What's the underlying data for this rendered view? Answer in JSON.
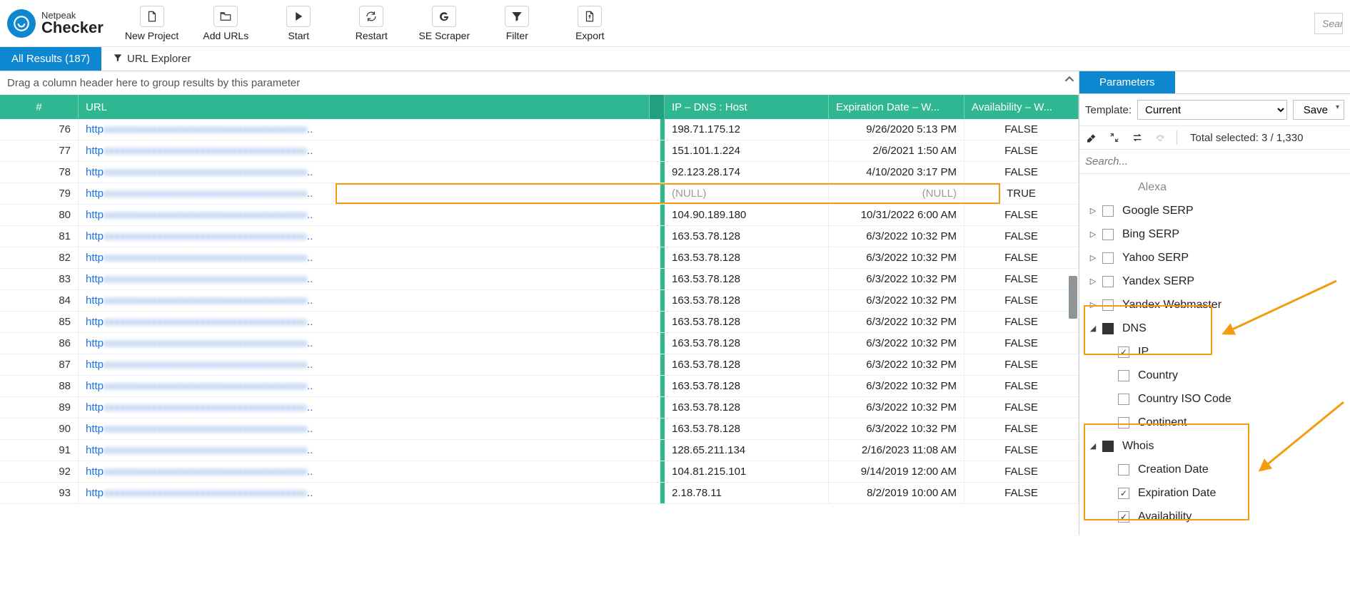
{
  "brand": {
    "top": "Netpeak",
    "product": "Checker"
  },
  "toolbar": [
    {
      "id": "new-project",
      "label": "New Project",
      "icon": "file"
    },
    {
      "id": "add-urls",
      "label": "Add URLs",
      "icon": "folder"
    },
    {
      "id": "start",
      "label": "Start",
      "icon": "play"
    },
    {
      "id": "restart",
      "label": "Restart",
      "icon": "refresh"
    },
    {
      "id": "se-scraper",
      "label": "SE Scraper",
      "icon": "g"
    },
    {
      "id": "filter",
      "label": "Filter",
      "icon": "funnel"
    },
    {
      "id": "export",
      "label": "Export",
      "icon": "export"
    }
  ],
  "searchPlaceholder": "Searcl",
  "tabs": {
    "results": "All Results (187)",
    "explorer": "URL Explorer"
  },
  "groupHint": "Drag a column header here to group results by this parameter",
  "columns": {
    "num": "#",
    "url": "URL",
    "ip": "IP  –  DNS  :  Host",
    "exp": "Expiration Date  –  W...",
    "av": "Availability  –  W..."
  },
  "rows": [
    {
      "n": 76,
      "ip": "198.71.175.12",
      "exp": "9/26/2020 5:13 PM",
      "av": "FALSE"
    },
    {
      "n": 77,
      "ip": "151.101.1.224",
      "exp": "2/6/2021 1:50 AM",
      "av": "FALSE"
    },
    {
      "n": 78,
      "ip": "92.123.28.174",
      "exp": "4/10/2020 3:17 PM",
      "av": "FALSE"
    },
    {
      "n": 79,
      "ip": "(NULL)",
      "exp": "(NULL)",
      "av": "TRUE",
      "null": true,
      "hl": true
    },
    {
      "n": 80,
      "ip": "104.90.189.180",
      "exp": "10/31/2022 6:00 AM",
      "av": "FALSE"
    },
    {
      "n": 81,
      "ip": "163.53.78.128",
      "exp": "6/3/2022 10:32 PM",
      "av": "FALSE"
    },
    {
      "n": 82,
      "ip": "163.53.78.128",
      "exp": "6/3/2022 10:32 PM",
      "av": "FALSE"
    },
    {
      "n": 83,
      "ip": "163.53.78.128",
      "exp": "6/3/2022 10:32 PM",
      "av": "FALSE"
    },
    {
      "n": 84,
      "ip": "163.53.78.128",
      "exp": "6/3/2022 10:32 PM",
      "av": "FALSE"
    },
    {
      "n": 85,
      "ip": "163.53.78.128",
      "exp": "6/3/2022 10:32 PM",
      "av": "FALSE"
    },
    {
      "n": 86,
      "ip": "163.53.78.128",
      "exp": "6/3/2022 10:32 PM",
      "av": "FALSE"
    },
    {
      "n": 87,
      "ip": "163.53.78.128",
      "exp": "6/3/2022 10:32 PM",
      "av": "FALSE"
    },
    {
      "n": 88,
      "ip": "163.53.78.128",
      "exp": "6/3/2022 10:32 PM",
      "av": "FALSE"
    },
    {
      "n": 89,
      "ip": "163.53.78.128",
      "exp": "6/3/2022 10:32 PM",
      "av": "FALSE"
    },
    {
      "n": 90,
      "ip": "163.53.78.128",
      "exp": "6/3/2022 10:32 PM",
      "av": "FALSE"
    },
    {
      "n": 91,
      "ip": "128.65.211.134",
      "exp": "2/16/2023 11:08 AM",
      "av": "FALSE"
    },
    {
      "n": 92,
      "ip": "104.81.215.101",
      "exp": "9/14/2019 12:00 AM",
      "av": "FALSE"
    },
    {
      "n": 93,
      "ip": "2.18.78.11",
      "exp": "8/2/2019 10:00 AM",
      "av": "FALSE"
    }
  ],
  "right": {
    "panelTab": "Parameters",
    "templateLabel": "Template:",
    "templateValue": "Current",
    "saveLabel": "Save",
    "totalSelected": "Total selected: 3 / 1,330",
    "searchPlaceholder": "Search...",
    "cutoffLabel": "Alexa",
    "groups": [
      {
        "label": "Google SERP",
        "checked": false
      },
      {
        "label": "Bing SERP",
        "checked": false
      },
      {
        "label": "Yahoo SERP",
        "checked": false
      },
      {
        "label": "Yandex SERP",
        "checked": false
      },
      {
        "label": "Yandex Webmaster",
        "checked": false
      }
    ],
    "dns": {
      "label": "DNS",
      "children": [
        {
          "label": "IP",
          "checked": true
        },
        {
          "label": "Country",
          "checked": false
        },
        {
          "label": "Country ISO Code",
          "checked": false
        },
        {
          "label": "Continent",
          "checked": false
        }
      ]
    },
    "whois": {
      "label": "Whois",
      "children": [
        {
          "label": "Creation Date",
          "checked": false
        },
        {
          "label": "Expiration Date",
          "checked": true
        },
        {
          "label": "Availability",
          "checked": true
        }
      ]
    }
  }
}
